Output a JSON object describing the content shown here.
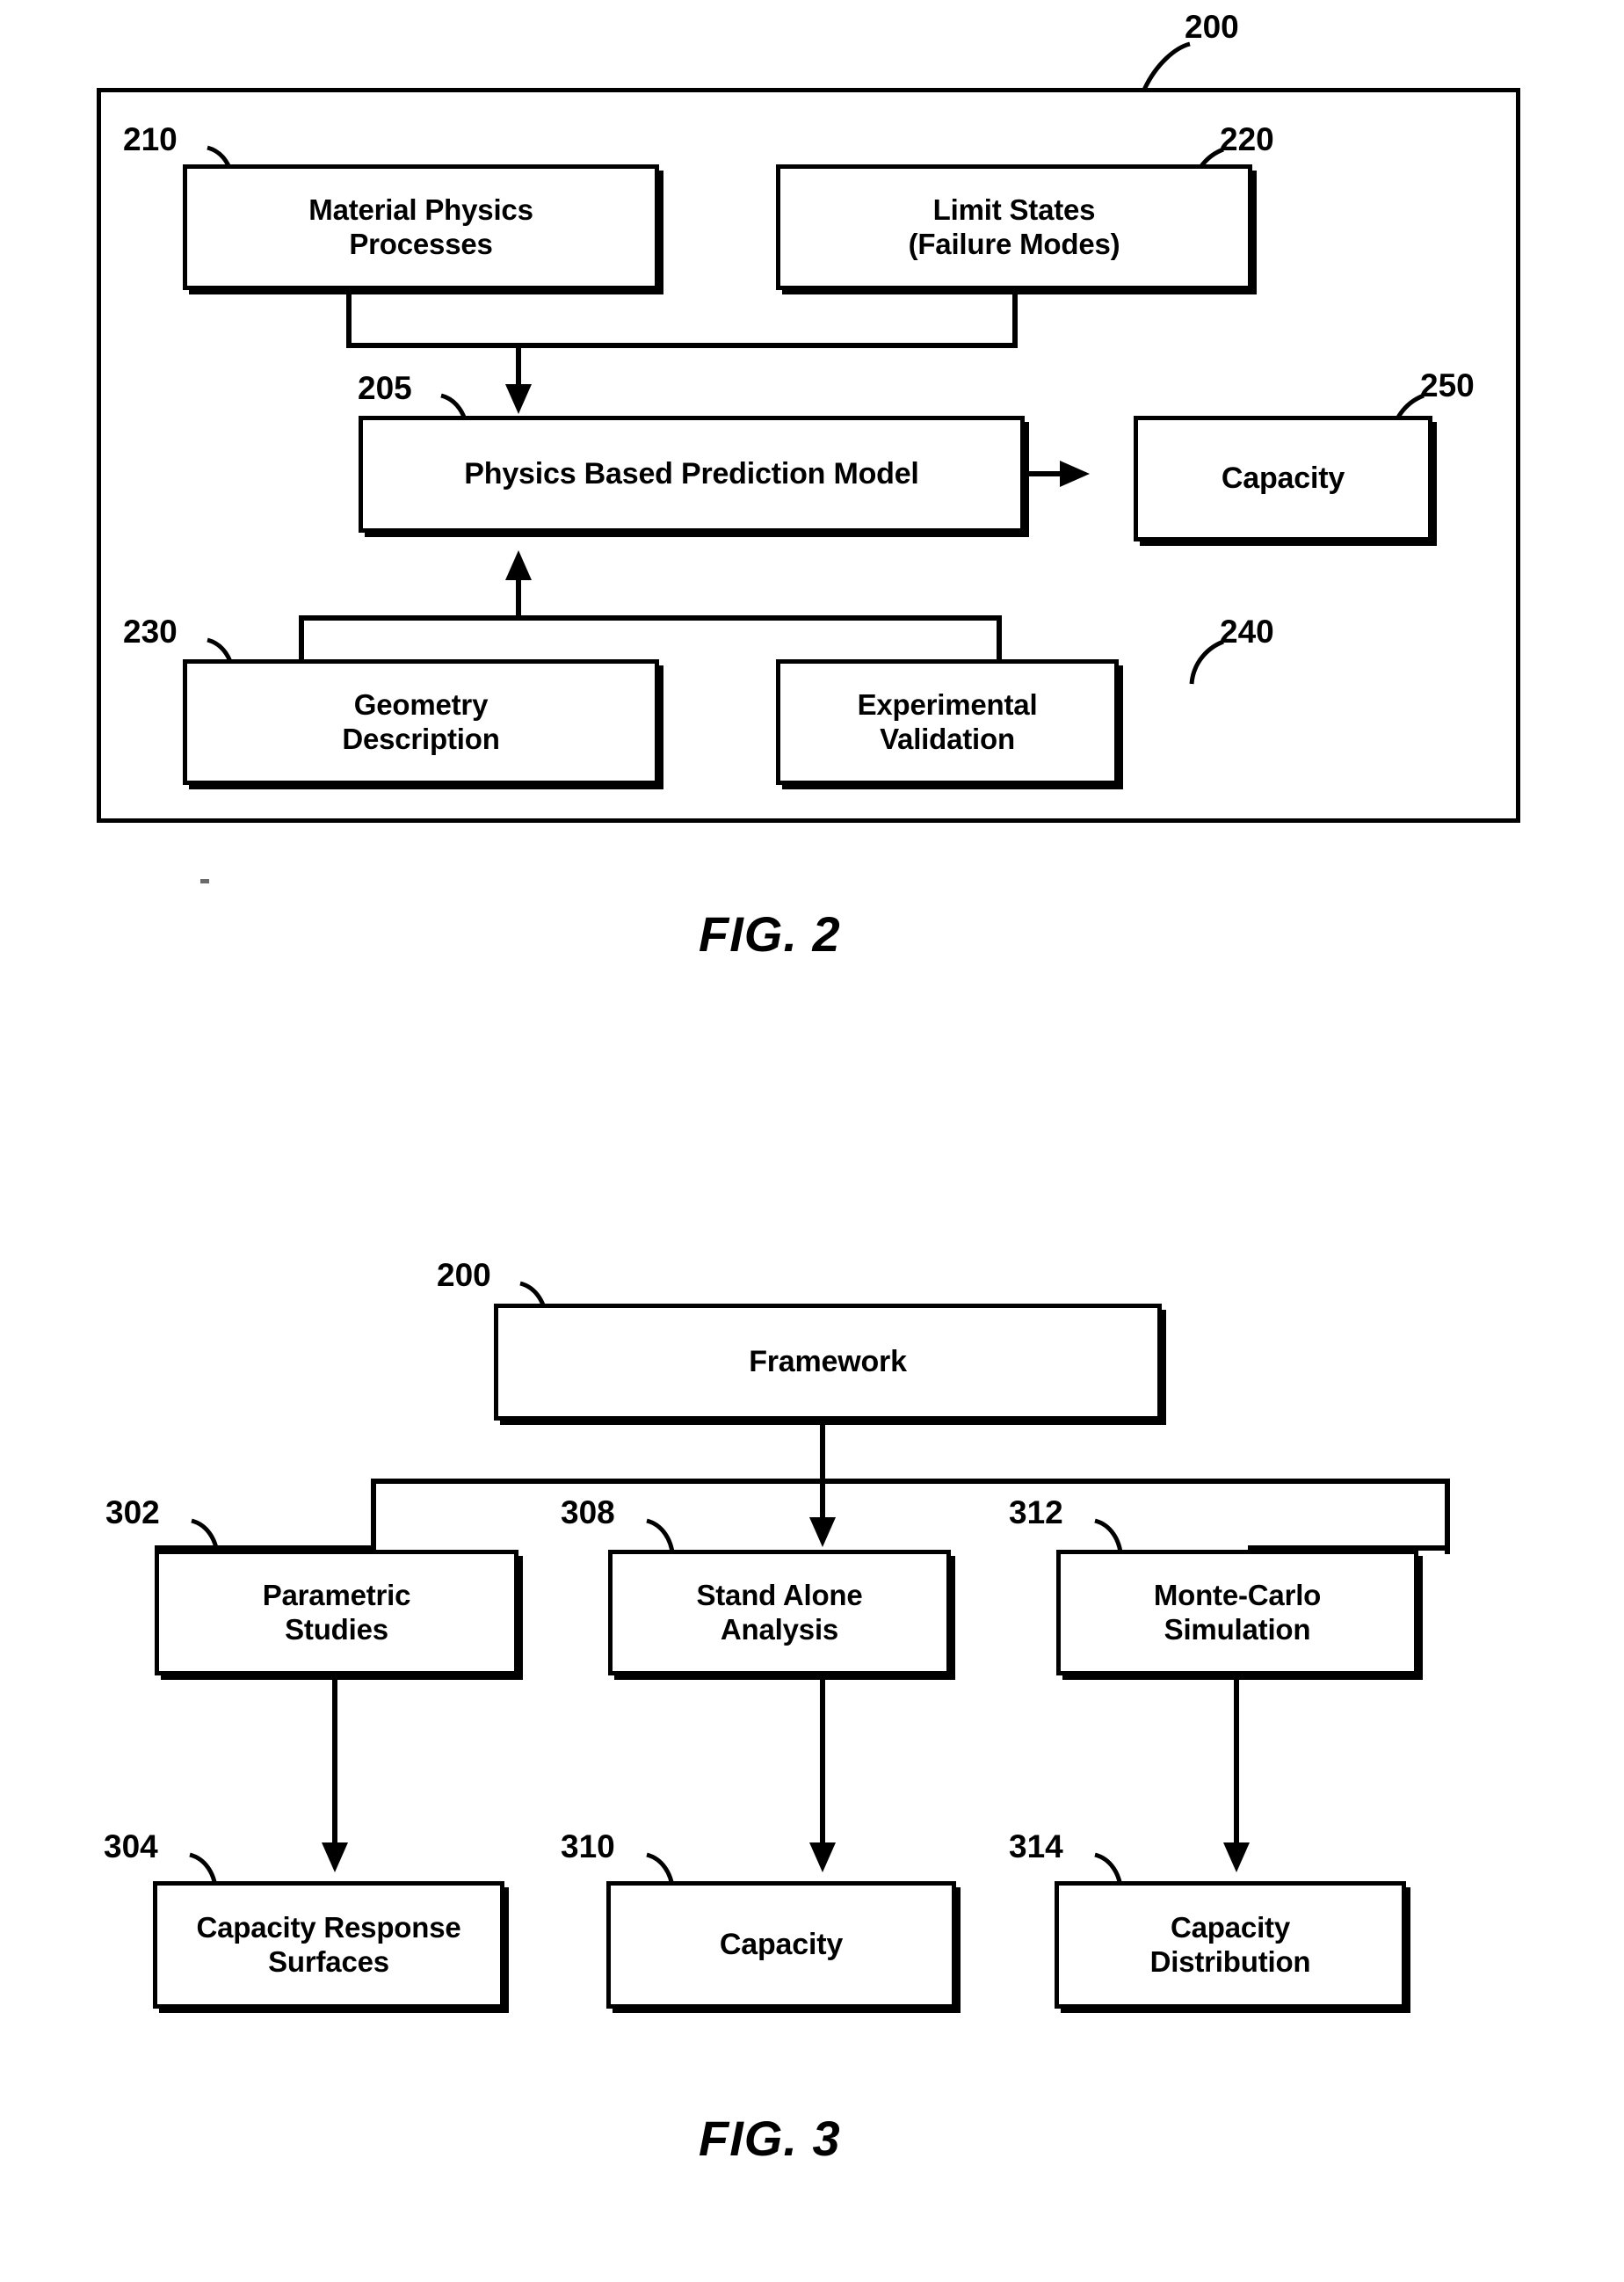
{
  "figures": [
    {
      "caption": "FIG. 2",
      "outer_ref": "200",
      "boxes": {
        "material_physics": {
          "ref": "210",
          "line1": "Material Physics",
          "line2": "Processes"
        },
        "limit_states": {
          "ref": "220",
          "line1": "Limit States",
          "line2": "(Failure Modes)"
        },
        "prediction_model": {
          "ref": "205",
          "line1": "Physics Based Prediction Model",
          "line2": ""
        },
        "capacity": {
          "ref": "250",
          "line1": "Capacity",
          "line2": ""
        },
        "geometry": {
          "ref": "230",
          "line1": "Geometry",
          "line2": "Description"
        },
        "experimental": {
          "ref": "240",
          "line1": "Experimental",
          "line2": "Validation"
        }
      }
    },
    {
      "caption": "FIG. 3",
      "boxes": {
        "framework": {
          "ref": "200",
          "line1": "Framework",
          "line2": ""
        },
        "parametric_studies": {
          "ref": "302",
          "line1": "Parametric",
          "line2": "Studies"
        },
        "stand_alone_analysis": {
          "ref": "308",
          "line1": "Stand Alone",
          "line2": "Analysis"
        },
        "monte_carlo": {
          "ref": "312",
          "line1": "Monte-Carlo",
          "line2": "Simulation"
        },
        "capacity_response": {
          "ref": "304",
          "line1": "Capacity Response",
          "line2": "Surfaces"
        },
        "capacity": {
          "ref": "310",
          "line1": "Capacity",
          "line2": ""
        },
        "capacity_distribution": {
          "ref": "314",
          "line1": "Capacity",
          "line2": "Distribution"
        }
      }
    }
  ],
  "colors": {
    "ink": "#000000",
    "paper": "#ffffff"
  }
}
